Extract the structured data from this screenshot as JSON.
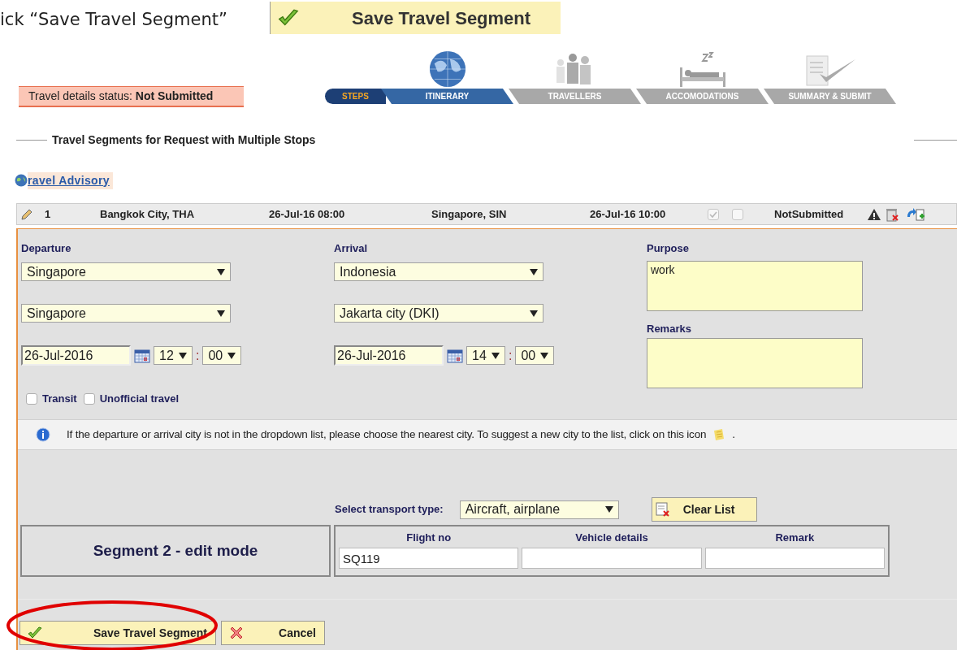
{
  "instruction": {
    "text": "ick “Save Travel Segment”",
    "button_label": "Save Travel Segment"
  },
  "status": {
    "label": "Travel details status:",
    "value": "Not Submitted"
  },
  "steps_label": "STEPS",
  "steps": [
    {
      "label": "ITINERARY",
      "selected": true
    },
    {
      "label": "TRAVELLERS",
      "selected": false
    },
    {
      "label": "ACCOMODATIONS",
      "selected": false
    },
    {
      "label": "SUMMARY & SUBMIT",
      "selected": false
    }
  ],
  "section_title": "Travel Segments for Request with Multiple Stops",
  "advisory_link": "ravel Advisory",
  "segment_row": {
    "number": "1",
    "from": "Bangkok City, THA",
    "departure": "26-Jul-16 08:00",
    "to": "Singapore, SIN",
    "arrival": "26-Jul-16 10:00",
    "check_1": true,
    "check_2": false,
    "status": "NotSubmitted"
  },
  "form": {
    "columns": [
      {
        "label": "Departure",
        "country": "Singapore",
        "city": "Singapore",
        "date": "26-Jul-2016",
        "hour": "12",
        "separator": ":",
        "minute": "00"
      },
      {
        "label": "Arrival",
        "country": "Indonesia",
        "city": "Jakarta city (DKI)",
        "date": "26-Jul-2016",
        "hour": "14",
        "separator": ":",
        "minute": "00"
      }
    ],
    "purpose_label": "Purpose",
    "purpose": "work",
    "remarks_label": "Remarks",
    "options": [
      {
        "label": "Transit",
        "checked": false
      },
      {
        "label": "Unofficial travel",
        "checked": false
      }
    ],
    "info": "If the departure or arrival city is not in the dropdown list, please choose the nearest city. To suggest a new city to the list, click on this icon",
    "info_end": "."
  },
  "transport": {
    "label": "Select transport type:",
    "value": "Aircraft, airplane",
    "clear_button": "Clear List"
  },
  "segment_caption": "Segment 2 - edit mode",
  "details_columns": [
    {
      "heading": "Flight no",
      "value": "SQ119"
    },
    {
      "heading": "Vehicle details"
    },
    {
      "heading": "Remark"
    }
  ],
  "buttons": [
    {
      "kind": "save",
      "label": "Save Travel Segment"
    },
    {
      "kind": "cancel",
      "label": "Cancel"
    }
  ]
}
